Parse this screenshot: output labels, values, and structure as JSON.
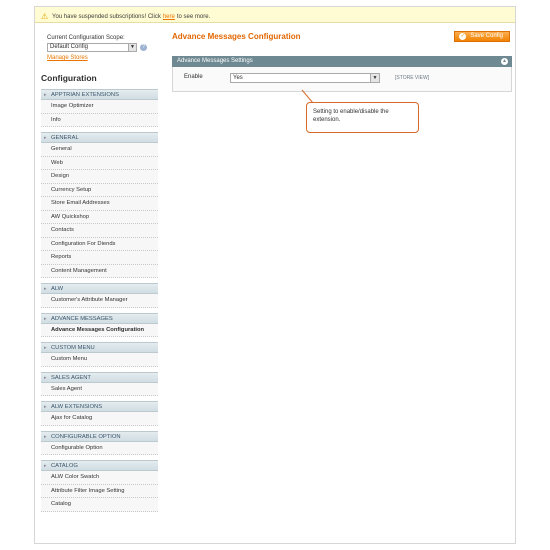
{
  "notice": {
    "text_before": "You have suspended subscriptions! Click",
    "link": "here",
    "text_after": "to see more."
  },
  "sidebar": {
    "scope_label": "Current Configuration Scope:",
    "scope_value": "Default Config",
    "manage_stores": "Manage Stores",
    "title": "Configuration",
    "sections": [
      {
        "title": "APPTRIAN EXTENSIONS",
        "items": [
          "Image Optimizer",
          "Info"
        ]
      },
      {
        "title": "GENERAL",
        "items": [
          "General",
          "Web",
          "Design",
          "Currency Setup",
          "Store Email Addresses",
          "AW Quickshop",
          "Contacts",
          "Configuration For Diends",
          "Reports",
          "Content Management"
        ]
      },
      {
        "title": "ALW",
        "items": [
          "Customer's Attribute Manager"
        ]
      },
      {
        "title": "ADVANCE MESSAGES",
        "items": [
          "Advance Messages Configuration"
        ]
      },
      {
        "title": "CUSTOM MENU",
        "items": [
          "Custom Menu"
        ]
      },
      {
        "title": "SALES AGENT",
        "items": [
          "Sales Agent"
        ]
      },
      {
        "title": "ALW EXTENSIONS",
        "items": [
          "Ajax for Catalog"
        ]
      },
      {
        "title": "CONFIGURABLE OPTION",
        "items": [
          "Configurable Option"
        ]
      },
      {
        "title": "CATALOG",
        "items": [
          "ALW Color Swatch",
          "Attribute Filter Image Setting",
          "Catalog"
        ]
      }
    ],
    "active_item": "Advance Messages Configuration"
  },
  "main": {
    "page_title": "Advance Messages Configuration",
    "save_button": "Save Config",
    "fieldset_title": "Advance Messages Settings",
    "enable_label": "Enable",
    "enable_value": "Yes",
    "scope_tag": "[STORE VIEW]",
    "callout": "Setting to enable/disable the extension."
  },
  "colors": {
    "accent": "#ea7601",
    "header_bar": "#6f8992",
    "section_header": "#d0dde3",
    "callout_border": "#d66a2a"
  },
  "icons": {
    "notice": "warning-icon",
    "scope_help": "help-icon",
    "save": "checkmark-icon",
    "collapse": "collapse-icon"
  }
}
